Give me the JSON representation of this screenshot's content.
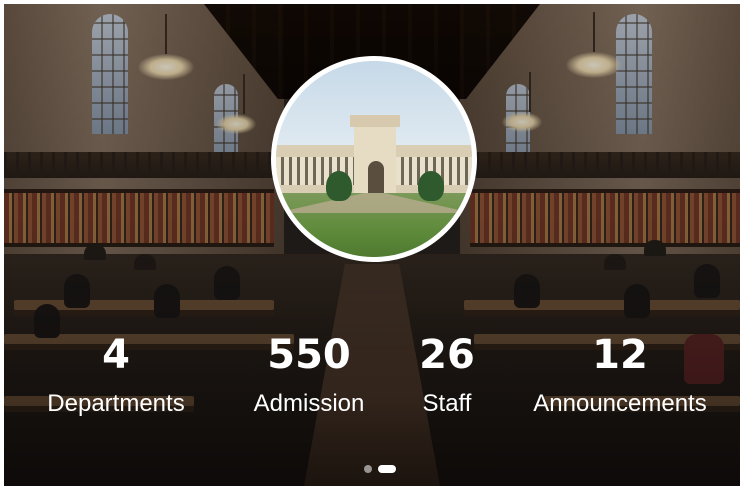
{
  "hero": {
    "background_image": "library-reading-room",
    "avatar_image": "campus-building-photo"
  },
  "stats": [
    {
      "value": "4",
      "label": "Departments"
    },
    {
      "value": "550",
      "label": "Admission"
    },
    {
      "value": "26",
      "label": "Staff"
    },
    {
      "value": "12",
      "label": "Announcements"
    }
  ],
  "pager": {
    "count": 2,
    "active_index": 1
  },
  "colors": {
    "text": "#ffffff",
    "avatar_border": "#ffffff",
    "dot_active": "#ffffff"
  }
}
